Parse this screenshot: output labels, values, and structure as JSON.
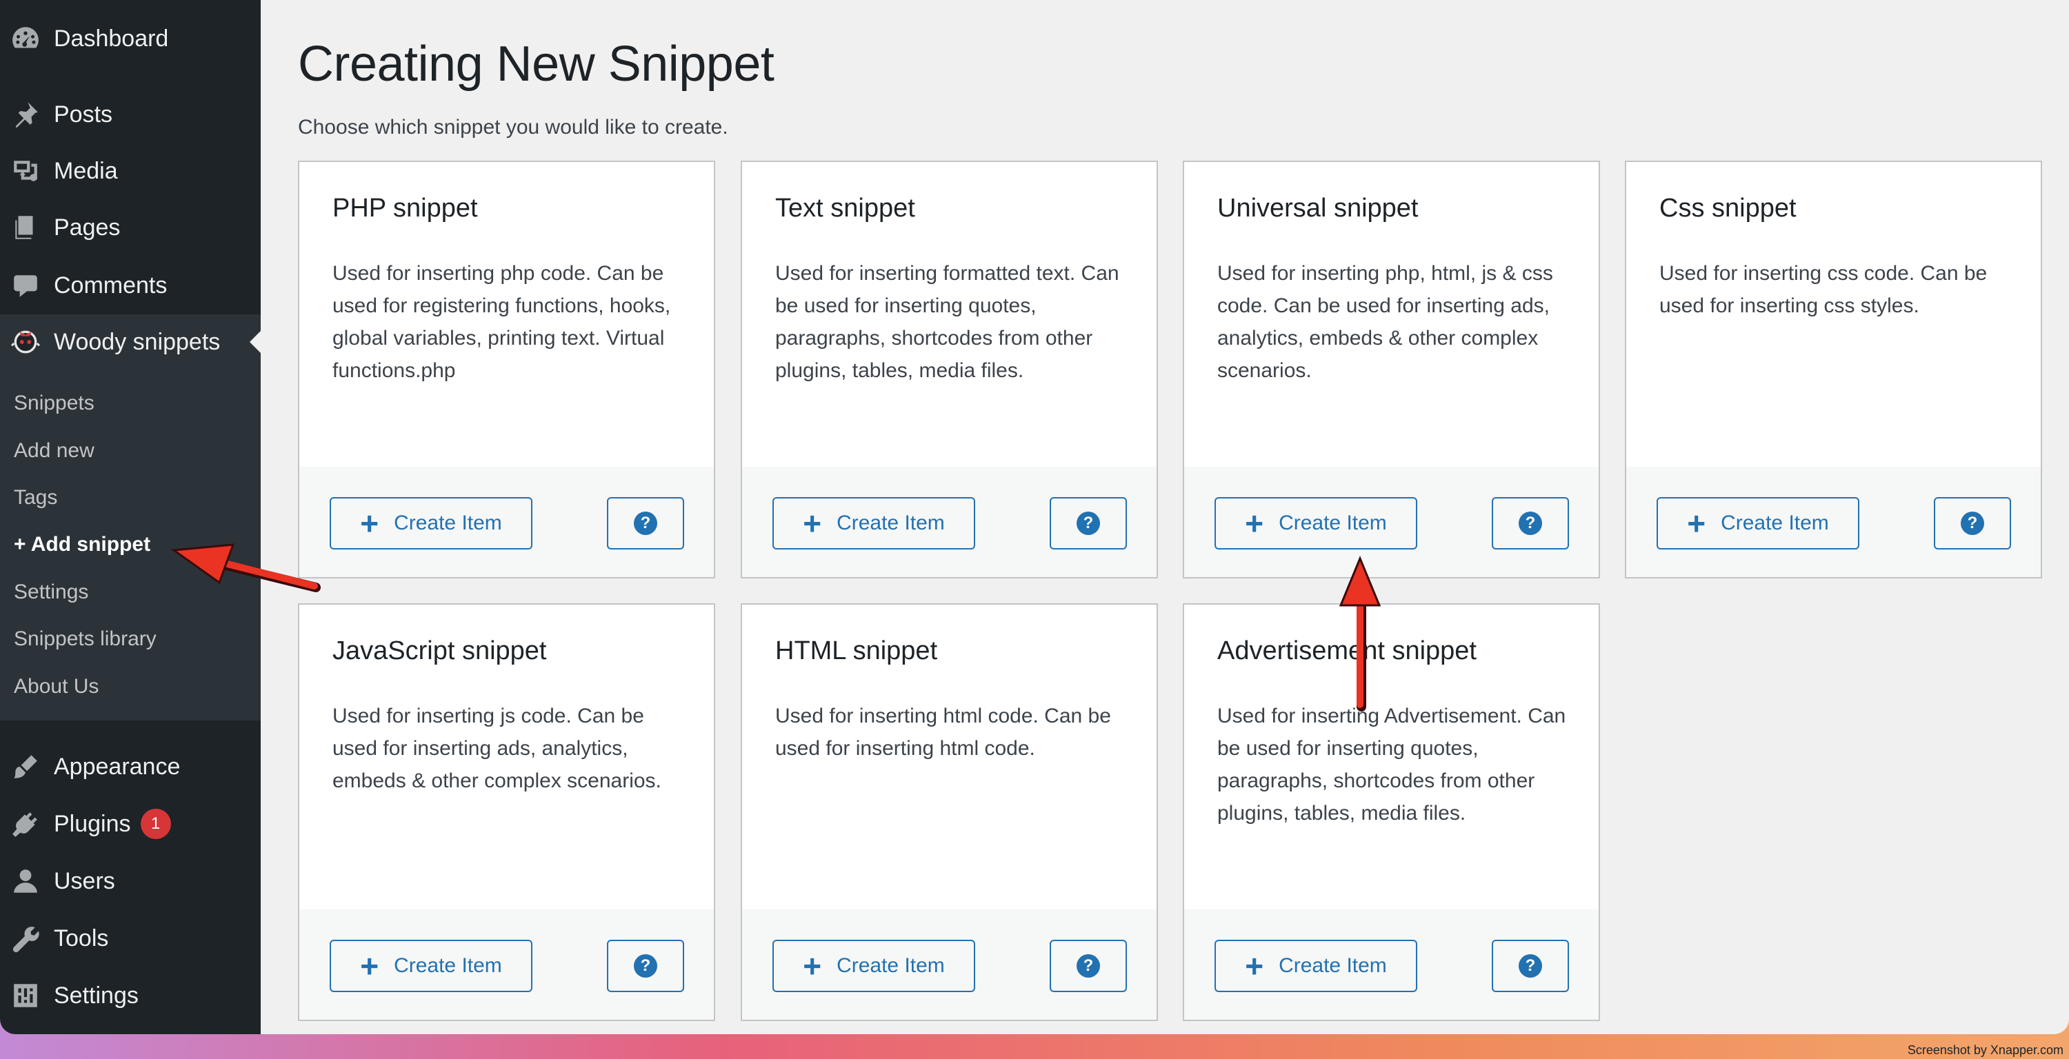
{
  "sidebar": {
    "items": [
      {
        "label": "Dashboard",
        "icon": "dashboard-icon"
      },
      {
        "label": "Posts",
        "icon": "pin-icon"
      },
      {
        "label": "Media",
        "icon": "media-icon"
      },
      {
        "label": "Pages",
        "icon": "pages-icon"
      },
      {
        "label": "Comments",
        "icon": "comment-icon"
      },
      {
        "label": "Woody snippets",
        "icon": "woody-logo-icon",
        "current": true
      },
      {
        "label": "Appearance",
        "icon": "brush-icon"
      },
      {
        "label": "Plugins",
        "icon": "plug-icon",
        "badge": "1"
      },
      {
        "label": "Users",
        "icon": "user-icon"
      },
      {
        "label": "Tools",
        "icon": "wrench-icon"
      },
      {
        "label": "Settings",
        "icon": "settings-icon"
      }
    ],
    "submenu": [
      {
        "label": "Snippets"
      },
      {
        "label": "Add new"
      },
      {
        "label": "Tags"
      },
      {
        "label": "+ Add snippet",
        "active": true
      },
      {
        "label": "Settings"
      },
      {
        "label": "Snippets library"
      },
      {
        "label": "About Us"
      }
    ]
  },
  "main": {
    "title": "Creating New Snippet",
    "subtitle": "Choose which snippet you would like to create.",
    "create_label": "Create Item",
    "help_symbol": "?",
    "cards": [
      {
        "title": "PHP snippet",
        "description": "Used for inserting php code. Can be used for registering functions, hooks, global variables, printing text. Virtual functions.php"
      },
      {
        "title": "Text snippet",
        "description": "Used for inserting formatted text. Can be used for inserting quotes, paragraphs, shortcodes from other plugins, tables, media files."
      },
      {
        "title": "Universal snippet",
        "description": "Used for inserting php, html, js & css code. Can be used for inserting ads, analytics, embeds & other complex scenarios."
      },
      {
        "title": "Css snippet",
        "description": "Used for inserting css code. Can be used for inserting css styles."
      },
      {
        "title": "JavaScript snippet",
        "description": "Used for inserting js code. Can be used for inserting ads, analytics, embeds & other complex scenarios."
      },
      {
        "title": "HTML snippet",
        "description": "Used for inserting html code. Can be used for inserting html code."
      },
      {
        "title": "Advertisement snippet",
        "description": "Used for inserting Advertisement. Can be used for inserting quotes, paragraphs, shortcodes from other plugins, tables, media files."
      }
    ]
  },
  "colors": {
    "sidebar_bg": "#1d2327",
    "submenu_bg": "#2c3338",
    "accent": "#2271b1",
    "badge": "#d63638",
    "annotation_arrow": "#ea3323"
  },
  "footer": {
    "credit": "Screenshot by Xnapper.com"
  }
}
